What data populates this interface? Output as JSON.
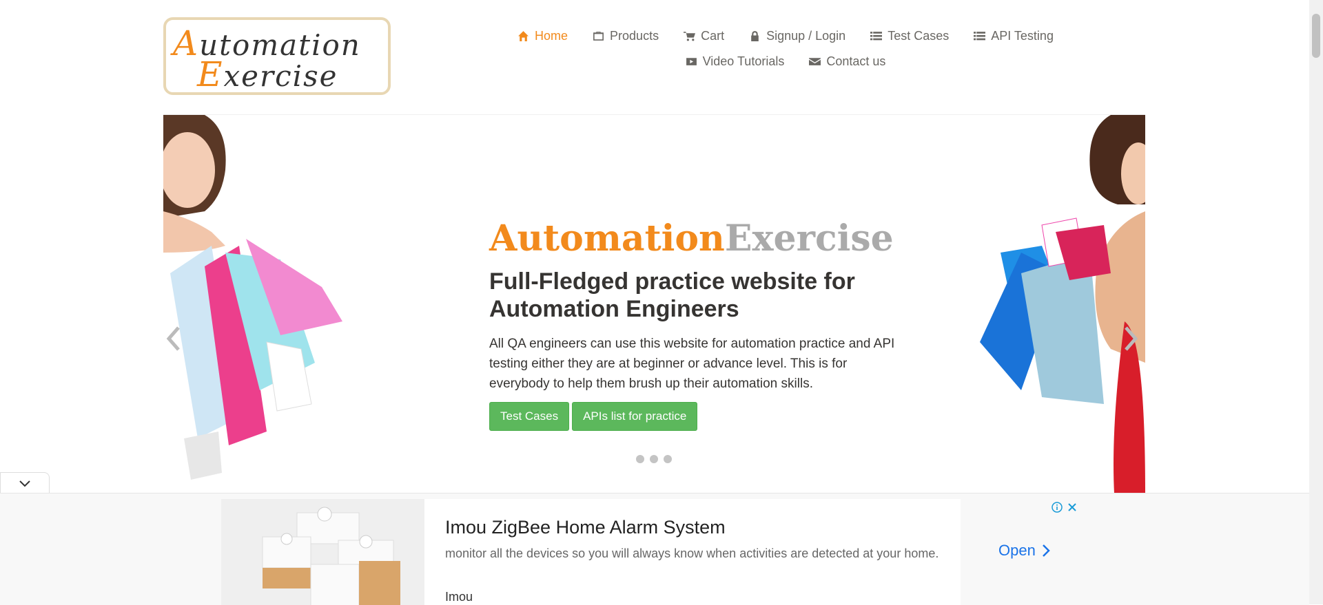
{
  "logo": {
    "line1_cap": "A",
    "line1_rest": "utomation",
    "line2_cap": "E",
    "line2_rest": "xercise"
  },
  "nav": {
    "row1": [
      {
        "label": "Home",
        "icon": "home-icon",
        "active": true
      },
      {
        "label": "Products",
        "icon": "briefcase-icon"
      },
      {
        "label": "Cart",
        "icon": "cart-icon"
      },
      {
        "label": "Signup / Login",
        "icon": "lock-icon"
      },
      {
        "label": "Test Cases",
        "icon": "list-icon"
      },
      {
        "label": "API Testing",
        "icon": "list-icon"
      }
    ],
    "row2": [
      {
        "label": "Video Tutorials",
        "icon": "youtube-play-icon"
      },
      {
        "label": "Contact us",
        "icon": "envelope-icon"
      }
    ]
  },
  "slider": {
    "brand_a": "Automation",
    "brand_b": "Exercise",
    "headline": "Full-Fledged practice website for Automation Engineers",
    "description": "All QA engineers can use this website for automation practice and API testing either they are at beginner or advance level. This is for everybody to help them brush up their automation skills.",
    "btn_test_cases": "Test Cases",
    "btn_apis": "APIs list for practice",
    "dots": 3
  },
  "ad": {
    "title": "Imou ZigBee Home Alarm System",
    "description": "monitor all the devices so you will always know when activities are detected at your home.",
    "brand": "Imou",
    "cta": "Open"
  },
  "colors": {
    "accent": "#f28a1c",
    "button_green": "#5cb85c",
    "ad_link": "#1a73e8"
  }
}
